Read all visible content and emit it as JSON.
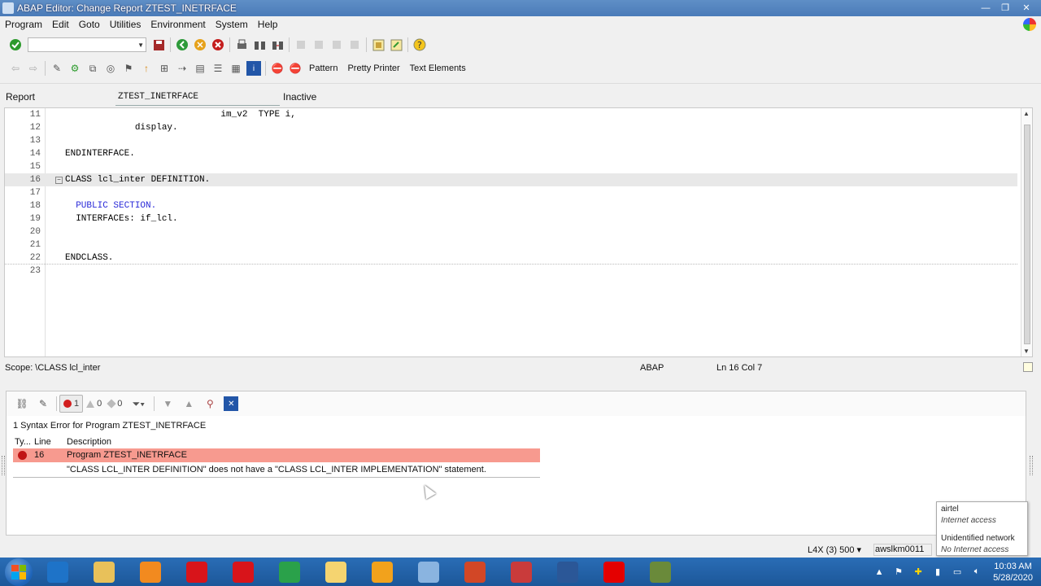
{
  "window": {
    "title": "ABAP Editor: Change Report ZTEST_INETRFACE"
  },
  "menu": [
    "Program",
    "Edit",
    "Goto",
    "Utilities",
    "Environment",
    "System",
    "Help"
  ],
  "toolbar1": {
    "command_field": {
      "value": "",
      "placeholder": ""
    }
  },
  "toolbar2": {
    "pattern_label": "Pattern",
    "pretty_printer_label": "Pretty Printer",
    "text_elements_label": "Text Elements"
  },
  "header": {
    "type_label": "Report",
    "program_name": "ZTEST_INETRFACE",
    "status": "Inactive"
  },
  "editor": {
    "lines": [
      {
        "num": "11",
        "text": "                             im_v2  TYPE i,"
      },
      {
        "num": "12",
        "text": "             display."
      },
      {
        "num": "13",
        "text": ""
      },
      {
        "num": "14",
        "text": "ENDINTERFACE."
      },
      {
        "num": "15",
        "text": ""
      },
      {
        "num": "16",
        "text": "CLASS lcl_inter DEFINITION."
      },
      {
        "num": "17",
        "text": ""
      },
      {
        "num": "18",
        "text": "  PUBLIC SECTION."
      },
      {
        "num": "19",
        "text": "  INTERFACEs: if_lcl."
      },
      {
        "num": "20",
        "text": ""
      },
      {
        "num": "21",
        "text": ""
      },
      {
        "num": "22",
        "text": "ENDCLASS."
      },
      {
        "num": "23",
        "text": ""
      }
    ],
    "current_line": "16"
  },
  "status": {
    "scope": "Scope: \\CLASS lcl_inter",
    "language": "ABAP",
    "position": "Ln 16 Col 7"
  },
  "errors": {
    "error_count": "1",
    "warning_count": "0",
    "info_count": "0",
    "summary": "1 Syntax Error for Program ZTEST_INETRFACE",
    "columns": {
      "type": "Ty...",
      "line": "Line",
      "description": "Description"
    },
    "rows": [
      {
        "line": "16",
        "title": "Program ZTEST_INETRFACE",
        "message": "\"CLASS LCL_INTER DEFINITION\" does not have a \"CLASS LCL_INTER IMPLEMENTATION\" statement."
      }
    ]
  },
  "system_status": {
    "system": "L4X (3) 500 ▾",
    "host": "awslkm0011"
  },
  "network_tooltip": {
    "name": "airtel",
    "status": "Internet access",
    "name2": "Unidentified network",
    "status2": "No Internet access"
  },
  "taskbar": {
    "apps": [
      {
        "icon": "internet-explorer-icon",
        "color": "#1e73c8"
      },
      {
        "icon": "file-explorer-icon",
        "color": "#e8c15a"
      },
      {
        "icon": "media-player-icon",
        "color": "#f28a1f"
      },
      {
        "icon": "opera-icon",
        "color": "#d8141a"
      },
      {
        "icon": "opera-icon",
        "color": "#d8141a"
      },
      {
        "icon": "chrome-icon",
        "color": "#2aa14a"
      },
      {
        "icon": "folder-icon",
        "color": "#f5d470"
      },
      {
        "icon": "sap-logon-icon",
        "color": "#f2a21c"
      },
      {
        "icon": "notepad-icon",
        "color": "#8ab4e0"
      },
      {
        "icon": "powerpoint-icon",
        "color": "#d24726"
      },
      {
        "icon": "snipping-tool-icon",
        "color": "#c93b3b"
      },
      {
        "icon": "word-icon",
        "color": "#2b5797"
      },
      {
        "icon": "airtel-icon",
        "color": "#e40000"
      },
      {
        "icon": "sap-gui-icon",
        "color": "#6a8a3a"
      }
    ],
    "clock_time": "10:03 AM",
    "clock_date": "5/28/2020"
  }
}
